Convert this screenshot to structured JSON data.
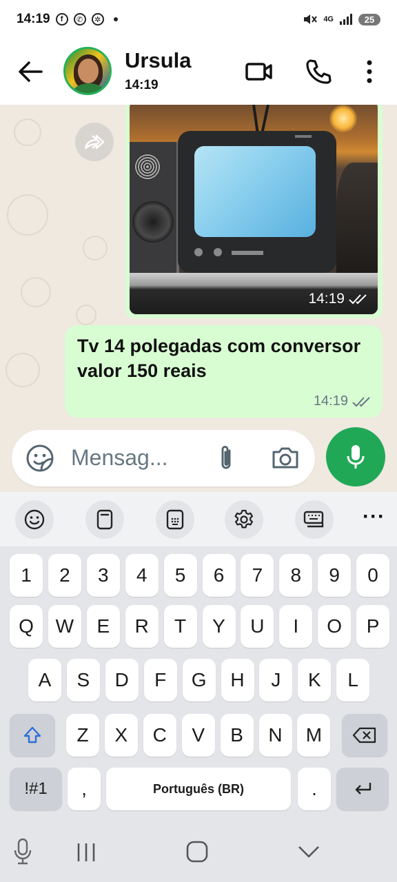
{
  "status_bar": {
    "time": "14:19",
    "network": "4G",
    "battery": "25"
  },
  "header": {
    "contact_name": "Ursula",
    "contact_status": "14:19"
  },
  "messages": [
    {
      "type": "image",
      "time": "14:19",
      "status": "read"
    },
    {
      "type": "text",
      "text": "Tv 14 polegadas com conversor valor 150 reais",
      "time": "14:19",
      "status": "read"
    }
  ],
  "composer": {
    "placeholder": "Mensag..."
  },
  "keyboard": {
    "row_numbers": [
      "1",
      "2",
      "3",
      "4",
      "5",
      "6",
      "7",
      "8",
      "9",
      "0"
    ],
    "row_1": [
      "Q",
      "W",
      "E",
      "R",
      "T",
      "Y",
      "U",
      "I",
      "O",
      "P"
    ],
    "row_2": [
      "A",
      "S",
      "D",
      "F",
      "G",
      "H",
      "J",
      "K",
      "L"
    ],
    "row_3": [
      "Z",
      "X",
      "C",
      "V",
      "B",
      "N",
      "M"
    ],
    "symbols_label": "!#1",
    "comma_label": ",",
    "space_label": "Português (BR)",
    "period_label": "."
  },
  "colors": {
    "accent_green": "#21a857",
    "bubble_green": "#d9fdd3",
    "chat_background": "#efe9e0"
  }
}
